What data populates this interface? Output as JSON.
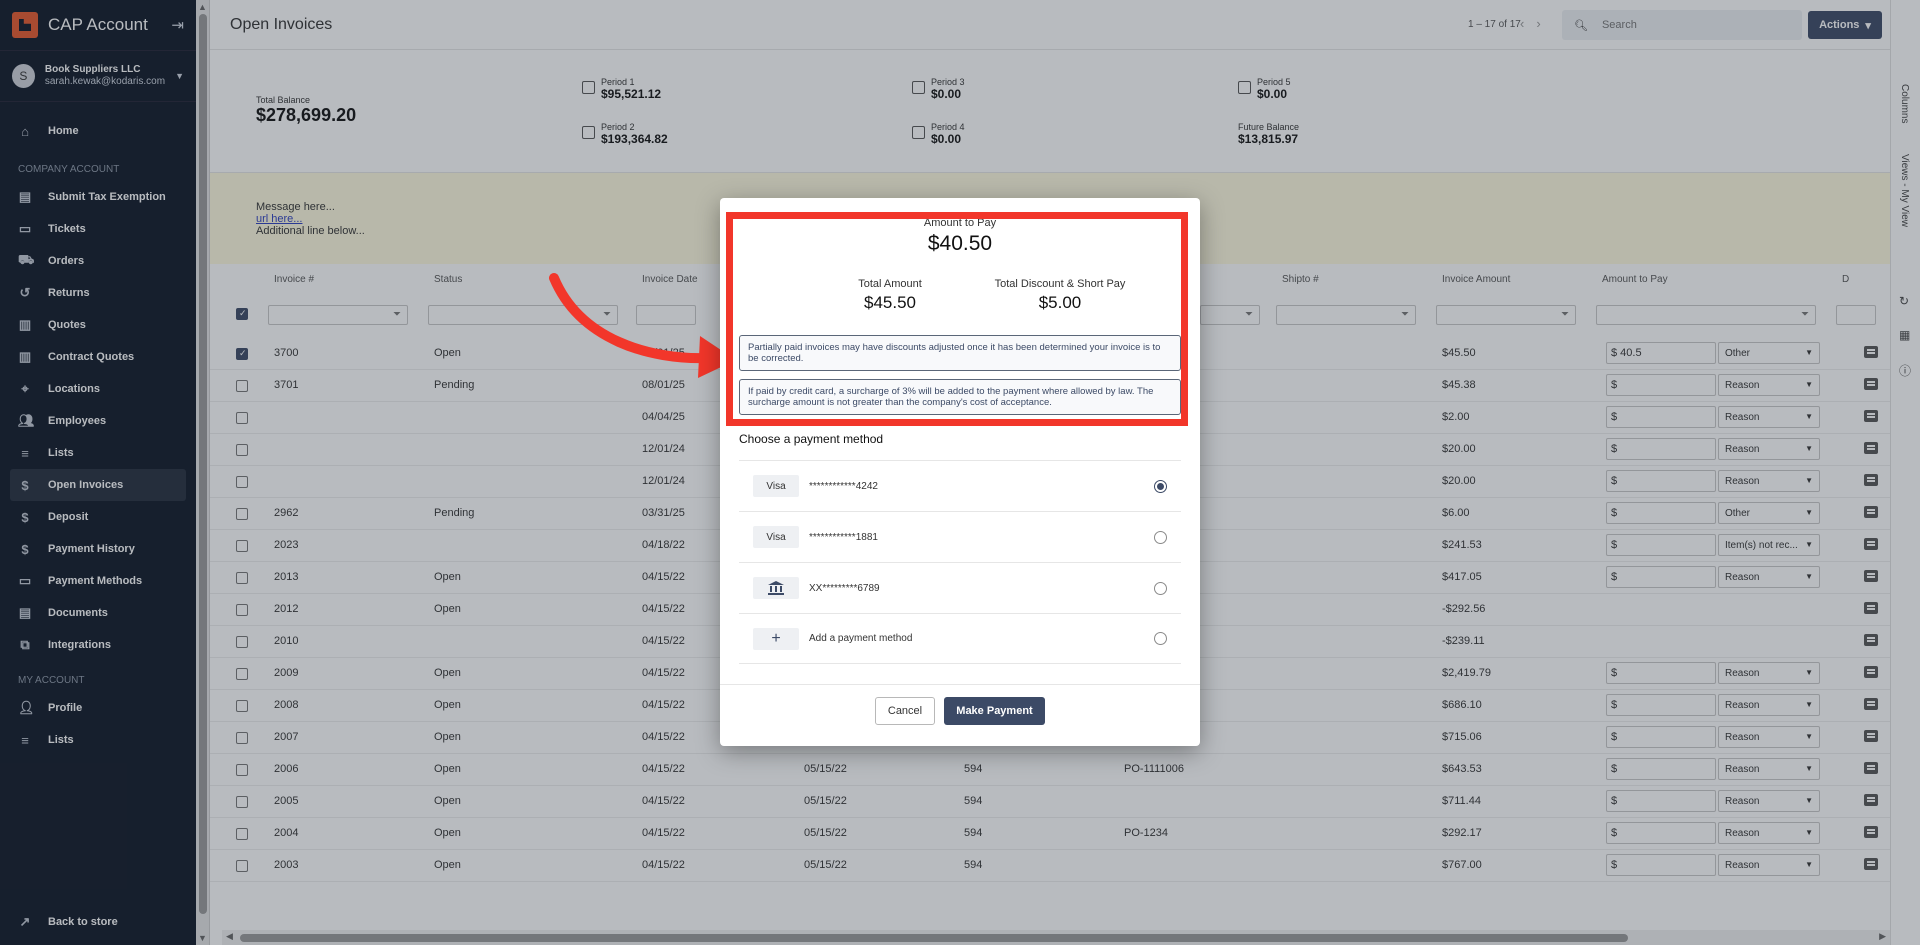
{
  "app": {
    "title": "CAP Account"
  },
  "account": {
    "avatar_initial": "S",
    "company": "Book Suppliers LLC",
    "email": "sarah.kewak@kodaris.com"
  },
  "sidebar": {
    "home": "Home",
    "section_company": "COMPANY ACCOUNT",
    "company_items": [
      {
        "label": "Submit Tax Exemption",
        "icon": "document-icon"
      },
      {
        "label": "Tickets",
        "icon": "ticket-icon"
      },
      {
        "label": "Orders",
        "icon": "truck-icon"
      },
      {
        "label": "Returns",
        "icon": "return-icon"
      },
      {
        "label": "Quotes",
        "icon": "clipboard-icon"
      },
      {
        "label": "Contract Quotes",
        "icon": "clipboard-icon"
      },
      {
        "label": "Locations",
        "icon": "location-icon"
      },
      {
        "label": "Employees",
        "icon": "people-icon"
      },
      {
        "label": "Lists",
        "icon": "list-icon"
      },
      {
        "label": "Open Invoices",
        "icon": "dollar-icon"
      },
      {
        "label": "Deposit",
        "icon": "dollar-icon"
      },
      {
        "label": "Payment History",
        "icon": "dollar-icon"
      },
      {
        "label": "Payment Methods",
        "icon": "card-icon"
      },
      {
        "label": "Documents",
        "icon": "document-icon"
      },
      {
        "label": "Integrations",
        "icon": "integration-icon"
      }
    ],
    "section_my": "MY ACCOUNT",
    "my_items": [
      {
        "label": "Profile",
        "icon": "person-icon"
      },
      {
        "label": "Lists",
        "icon": "list-icon"
      }
    ],
    "back": "Back to store"
  },
  "header": {
    "title": "Open Invoices",
    "pager": "1 – 17 of 17",
    "search_placeholder": "Search",
    "actions_label": "Actions"
  },
  "balances": {
    "total_label": "Total Balance",
    "total_value": "$278,699.20",
    "periods": [
      {
        "label": "Period 1",
        "value": "$95,521.12"
      },
      {
        "label": "Period 2",
        "value": "$193,364.82"
      },
      {
        "label": "Period 3",
        "value": "$0.00"
      },
      {
        "label": "Period 4",
        "value": "$0.00"
      },
      {
        "label": "Period 5",
        "value": "$0.00"
      }
    ],
    "future_label": "Future Balance",
    "future_value": "$13,815.97"
  },
  "message": {
    "line1": "Message here...",
    "link": "url here...",
    "line3": "Additional line below..."
  },
  "grid": {
    "columns": [
      "Invoice #",
      "Status",
      "Invoice Date",
      "Shipto #",
      "Invoice Amount",
      "Amount to Pay",
      "D"
    ],
    "rows": [
      {
        "inv": "3700",
        "status": "Open",
        "date": "03/01/25",
        "due": "",
        "num": "",
        "po": "",
        "amount": "$45.50",
        "pay": "$ 40.5",
        "reason": "Other",
        "checked": true
      },
      {
        "inv": "3701",
        "status": "Pending",
        "date": "08/01/25",
        "due": "",
        "num": "",
        "po": "",
        "amount": "$45.38",
        "pay": "$",
        "reason": "Reason",
        "checked": false
      },
      {
        "inv": "",
        "status": "",
        "date": "04/04/25",
        "due": "",
        "num": "",
        "po": "",
        "amount": "$2.00",
        "pay": "$",
        "reason": "Reason",
        "checked": false
      },
      {
        "inv": "",
        "status": "",
        "date": "12/01/24",
        "due": "",
        "num": "",
        "po": "",
        "amount": "$20.00",
        "pay": "$",
        "reason": "Reason",
        "checked": false
      },
      {
        "inv": "",
        "status": "",
        "date": "12/01/24",
        "due": "",
        "num": "",
        "po": "",
        "amount": "$20.00",
        "pay": "$",
        "reason": "Reason",
        "checked": false
      },
      {
        "inv": "2962",
        "status": "Pending",
        "date": "03/31/25",
        "due": "",
        "num": "",
        "po": "",
        "amount": "$6.00",
        "pay": "$",
        "reason": "Other",
        "checked": false
      },
      {
        "inv": "2023",
        "status": "",
        "date": "04/18/22",
        "due": "",
        "num": "",
        "po": "",
        "amount": "$241.53",
        "pay": "$",
        "reason": "Item(s) not rec...",
        "checked": false
      },
      {
        "inv": "2013",
        "status": "Open",
        "date": "04/15/22",
        "due": "",
        "num": "",
        "po": "",
        "amount": "$417.05",
        "pay": "$",
        "reason": "Reason",
        "checked": false
      },
      {
        "inv": "2012",
        "status": "Open",
        "date": "04/15/22",
        "due": "",
        "num": "",
        "po": "",
        "amount": "-$292.56",
        "pay": "",
        "reason": "",
        "checked": false
      },
      {
        "inv": "2010",
        "status": "",
        "date": "04/15/22",
        "due": "",
        "num": "",
        "po": "",
        "amount": "-$239.11",
        "pay": "",
        "reason": "",
        "checked": false
      },
      {
        "inv": "2009",
        "status": "Open",
        "date": "04/15/22",
        "due": "",
        "num": "",
        "po": "",
        "amount": "$2,419.79",
        "pay": "$",
        "reason": "Reason",
        "checked": false
      },
      {
        "inv": "2008",
        "status": "Open",
        "date": "04/15/22",
        "due": "",
        "num": "",
        "po": "",
        "amount": "$686.10",
        "pay": "$",
        "reason": "Reason",
        "checked": false
      },
      {
        "inv": "2007",
        "status": "Open",
        "date": "04/15/22",
        "due": "",
        "num": "",
        "po": "",
        "amount": "$715.06",
        "pay": "$",
        "reason": "Reason",
        "checked": false
      },
      {
        "inv": "2006",
        "status": "Open",
        "date": "04/15/22",
        "due": "05/15/22",
        "num": "594",
        "po": "PO-1111006",
        "amount": "$643.53",
        "pay": "$",
        "reason": "Reason",
        "checked": false
      },
      {
        "inv": "2005",
        "status": "Open",
        "date": "04/15/22",
        "due": "05/15/22",
        "num": "594",
        "po": "",
        "amount": "$711.44",
        "pay": "$",
        "reason": "Reason",
        "checked": false
      },
      {
        "inv": "2004",
        "status": "Open",
        "date": "04/15/22",
        "due": "05/15/22",
        "num": "594",
        "po": "PO-1234",
        "amount": "$292.17",
        "pay": "$",
        "reason": "Reason",
        "checked": false
      },
      {
        "inv": "2003",
        "status": "Open",
        "date": "04/15/22",
        "due": "05/15/22",
        "num": "594",
        "po": "",
        "amount": "$767.00",
        "pay": "$",
        "reason": "Reason",
        "checked": false
      }
    ]
  },
  "right_rail": {
    "columns": "Columns",
    "views": "Views - My View"
  },
  "dialog": {
    "amount_label": "Amount to Pay",
    "amount_value": "$40.50",
    "total_label": "Total Amount",
    "total_value": "$45.50",
    "discount_label": "Total Discount & Short Pay",
    "discount_value": "$5.00",
    "note1": "Partially paid invoices may have discounts adjusted once it has been determined your invoice is to be corrected.",
    "note2": "If paid by credit card, a surcharge of 3% will be added to the payment where allowed by law. The surcharge amount is not greater than the company's cost of acceptance.",
    "choose_label": "Choose a payment method",
    "methods": [
      {
        "tag": "Visa",
        "text": "************4242",
        "selected": true
      },
      {
        "tag": "Visa",
        "text": "************1881",
        "selected": false
      },
      {
        "tag": "bank-icon",
        "text": "XX*********6789",
        "selected": false
      },
      {
        "tag": "plus-icon",
        "text": "Add a payment method",
        "selected": false
      }
    ],
    "cancel_label": "Cancel",
    "pay_label": "Make Payment",
    "highlight_color": "#f2362a"
  }
}
